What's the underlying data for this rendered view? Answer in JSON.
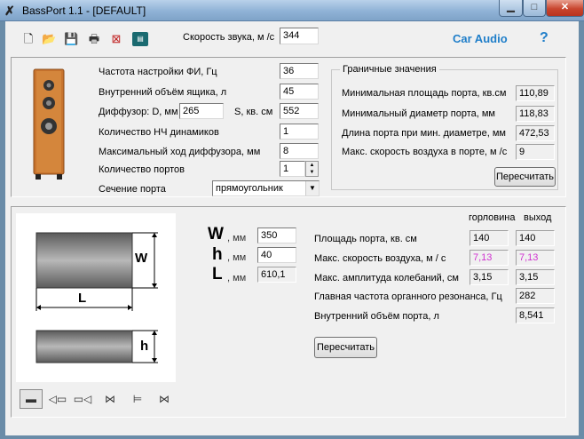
{
  "window": {
    "title": "BassPort 1.1 - [DEFAULT]"
  },
  "toolbar": {
    "sound_speed_label": "Скорость звука, м /с",
    "sound_speed_value": "344",
    "brand": "Car Audio",
    "help": "?"
  },
  "speaker": {
    "tuning_freq_label": "Частота настройки ФИ, Гц",
    "tuning_freq_value": "36",
    "box_volume_label": "Внутренний объём ящика, л",
    "box_volume_value": "45",
    "diffuser_label": "Диффузор: D, мм",
    "diffuser_d_value": "265",
    "diffuser_s_label": "S, кв. см",
    "diffuser_s_value": "552",
    "woofer_count_label": "Количество НЧ динамиков",
    "woofer_count_value": "1",
    "max_excursion_label": "Максимальный ход диффузора, мм",
    "max_excursion_value": "8",
    "port_count_label": "Количество портов",
    "port_count_value": "1",
    "port_section_label": "Сечение порта",
    "port_section_value": "прямоугольник"
  },
  "limits": {
    "title": "Граничные значения",
    "rows": [
      {
        "label": "Минимальная площадь порта, кв.см",
        "value": "110,89"
      },
      {
        "label": "Минимальный диаметр порта, мм",
        "value": "118,83"
      },
      {
        "label": "Длина порта при мин. диаметре, мм",
        "value": "472,53"
      },
      {
        "label": "Макс. скорость воздуха в порте, м /с",
        "value": "9"
      }
    ],
    "recalc_label": "Пересчитать"
  },
  "dimensions": {
    "w_letter": "W",
    "w_unit": ", мм",
    "w_value": "350",
    "h_letter": "h",
    "h_unit": ", мм",
    "h_value": "40",
    "l_letter": "L",
    "l_unit": ", мм",
    "l_value": "610,1",
    "diagram_w": "W",
    "diagram_l": "L",
    "diagram_h": "h"
  },
  "results": {
    "col_throat": "горловина",
    "col_exit": "выход",
    "rows": [
      {
        "label": "Площадь порта, кв. см",
        "throat": "140",
        "exit": "140"
      },
      {
        "label": "Макс. скорость воздуха, м / с",
        "throat": "7,13",
        "exit": "7,13"
      },
      {
        "label": "Макс. амплитуда колебаний, см",
        "throat": "3,15",
        "exit": "3,15"
      },
      {
        "label": "Главная частота органного резонанса, Гц",
        "value": "282"
      },
      {
        "label": "Внутренний объём порта, л",
        "value": "8,541"
      }
    ],
    "recalc_label": "Пересчитать"
  },
  "colors": {
    "accent": "#1f7ec9",
    "highlight": "#d030d0",
    "speaker_wood": "#c8742e"
  }
}
